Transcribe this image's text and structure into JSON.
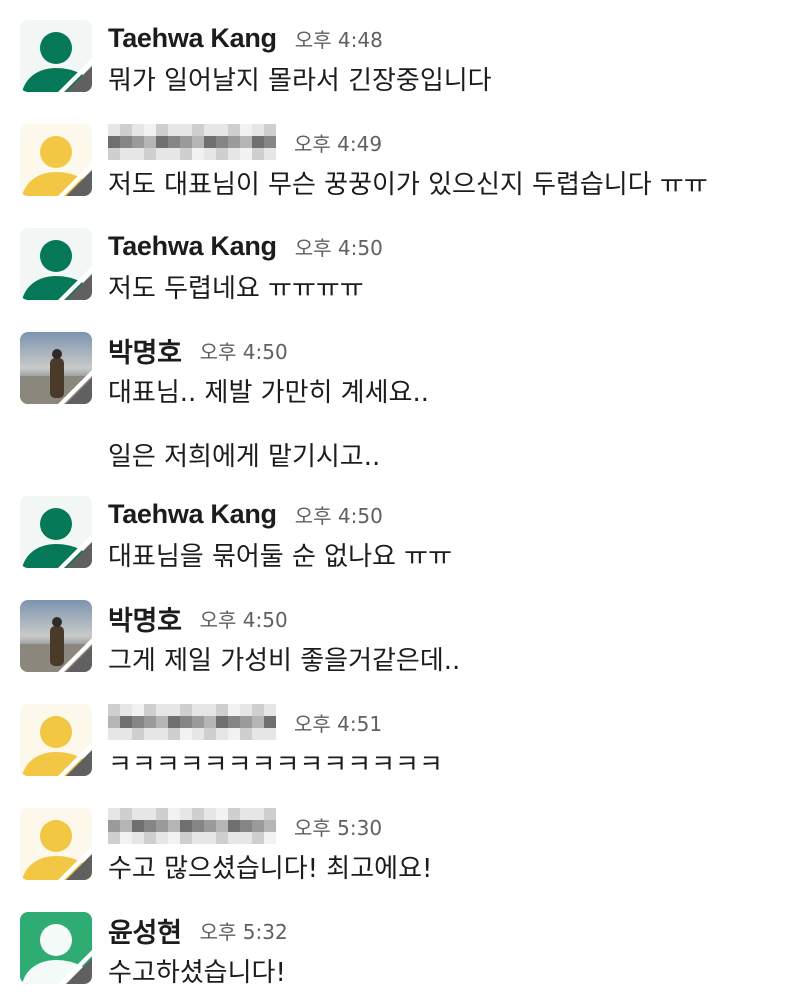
{
  "messages": [
    {
      "author": "Taehwa Kang",
      "avatar": "green",
      "time": "오후 4:48",
      "lines": [
        "뭐가 일어날지 몰라서 긴장중입니다"
      ]
    },
    {
      "author": null,
      "avatar": "yellow",
      "time": "오후 4:49",
      "lines": [
        "저도 대표님이 무슨 꿍꿍이가 있으신지 두렵습니다 ㅠㅠ"
      ]
    },
    {
      "author": "Taehwa Kang",
      "avatar": "green",
      "time": "오후 4:50",
      "lines": [
        "저도 두렵네요 ㅠㅠㅠㅠ"
      ]
    },
    {
      "author": "박명호",
      "avatar": "photo",
      "time": "오후 4:50",
      "lines": [
        "대표님.. 제발 가만히 계세요..",
        "일은 저희에게 맡기시고.."
      ]
    },
    {
      "author": "Taehwa Kang",
      "avatar": "green",
      "time": "오후 4:50",
      "lines": [
        "대표님을 묶어둘 순 없나요 ㅠㅠ"
      ]
    },
    {
      "author": "박명호",
      "avatar": "photo",
      "time": "오후 4:50",
      "lines": [
        "그게 제일 가성비 좋을거같은데.."
      ]
    },
    {
      "author": null,
      "avatar": "yellow",
      "time": "오후 4:51",
      "lines": [
        "ㅋㅋㅋㅋㅋㅋㅋㅋㅋㅋㅋㅋㅋㅋ"
      ]
    },
    {
      "author": null,
      "avatar": "yellow",
      "time": "오후 5:30",
      "lines": [
        "수고 많으셨습니다! 최고에요!"
      ]
    },
    {
      "author": "윤성현",
      "avatar": "teal",
      "time": "오후 5:32",
      "lines": [
        "수고하셨습니다!"
      ]
    }
  ],
  "colors": {
    "green": {
      "bg": "#f2f7f6",
      "fg": "#047857"
    },
    "yellow": {
      "bg": "#fdf8ec",
      "fg": "#f2c744"
    },
    "teal": {
      "bg": "#2fac74",
      "fg": "#f3faf7"
    }
  }
}
